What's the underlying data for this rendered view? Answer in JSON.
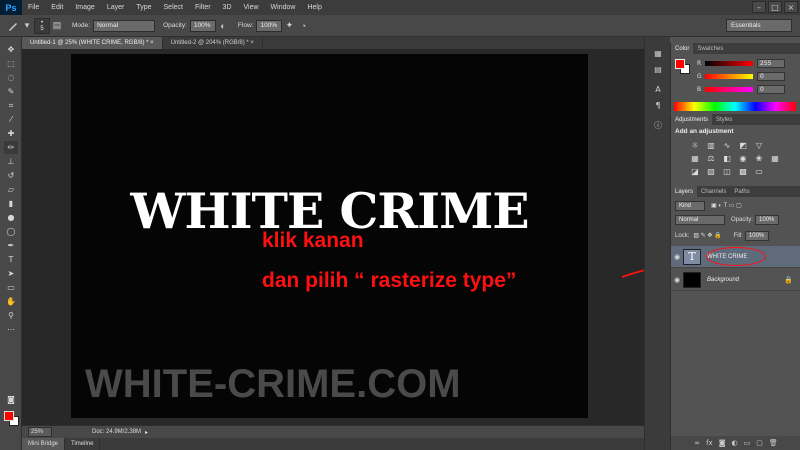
{
  "app": {
    "logo": "Ps",
    "menu": [
      "File",
      "Edit",
      "Image",
      "Layer",
      "Type",
      "Select",
      "Filter",
      "3D",
      "View",
      "Window",
      "Help"
    ],
    "window_controls": [
      "–",
      "□",
      "×"
    ]
  },
  "options": {
    "brush_size": "5",
    "mode_label": "Mode:",
    "mode_value": "Normal",
    "opacity_label": "Opacity:",
    "opacity_value": "100%",
    "flow_label": "Flow:",
    "flow_value": "100%",
    "workspace": "Essentials"
  },
  "documents": {
    "tabs": [
      {
        "label": "Untitled-1 @ 25% (WHITE CRIME, RGB/8) *  ×"
      },
      {
        "label": "Untitled-2 @ 204% (RGB/8) *  ×"
      }
    ]
  },
  "canvas": {
    "title": "WHITE CRIME",
    "watermark": "WHITE-CRIME.COM",
    "annotation_line1": "klik kanan",
    "annotation_line2": "dan pilih “ rasterize type”"
  },
  "status": {
    "zoom": "25%",
    "doc_info": "Doc: 24.9M/2.38M"
  },
  "bottom_tabs": [
    "Mini Bridge",
    "Timeline"
  ],
  "color_panel": {
    "tabs": [
      "Color",
      "Swatches"
    ],
    "r_label": "R",
    "r_value": "255",
    "g_label": "G",
    "g_value": "0",
    "b_label": "B",
    "b_value": "0",
    "fg_color": "#ff0000",
    "bg_color": "#ffffff"
  },
  "adjustments_panel": {
    "tabs": [
      "Adjustments",
      "Styles"
    ],
    "title": "Add an adjustment"
  },
  "layers_panel": {
    "tabs": [
      "Layers",
      "Channels",
      "Paths"
    ],
    "kind": "Kind",
    "blend_mode": "Normal",
    "opacity_label": "Opacity:",
    "opacity_value": "100%",
    "lock_label": "Lock:",
    "fill_label": "Fill:",
    "fill_value": "100%",
    "layers": [
      {
        "name": "WHITE CRIME",
        "thumb": "T"
      },
      {
        "name": "Background",
        "thumb": ""
      }
    ]
  },
  "accent_color": "#ff1010"
}
